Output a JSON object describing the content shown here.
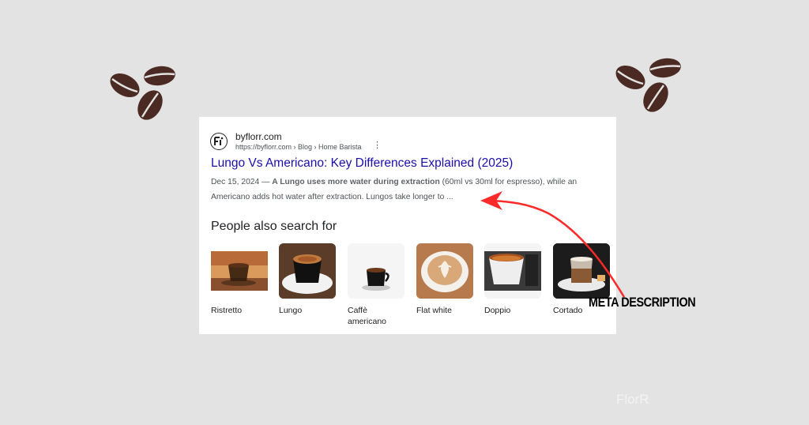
{
  "result": {
    "site_name": "byflorr.com",
    "site_url": "https://byflorr.com › Blog › Home Barista",
    "title": "Lungo Vs Americano: Key Differences Explained (2025)",
    "snippet_date": "Dec 15, 2024 — ",
    "snippet_bold": "A Lungo uses more water during extraction",
    "snippet_rest_1": " (60ml vs 30ml for espresso), while an",
    "snippet_line_2": "Americano adds hot water after extraction. Lungos take longer to ..."
  },
  "people_also_search": {
    "heading": "People also search for",
    "items": [
      {
        "label": "Ristretto"
      },
      {
        "label": "Lungo"
      },
      {
        "label": "Caffè americano"
      },
      {
        "label": "Flat white"
      },
      {
        "label": "Doppio"
      },
      {
        "label": "Cortado"
      }
    ]
  },
  "annotation": {
    "label": "META DESCRIPTION",
    "arrow_color": "#ff2a2a"
  },
  "watermark": "FlorR",
  "colors": {
    "background": "#e3e3e3",
    "link": "#1a0dab",
    "bean": "#4a2a22"
  }
}
